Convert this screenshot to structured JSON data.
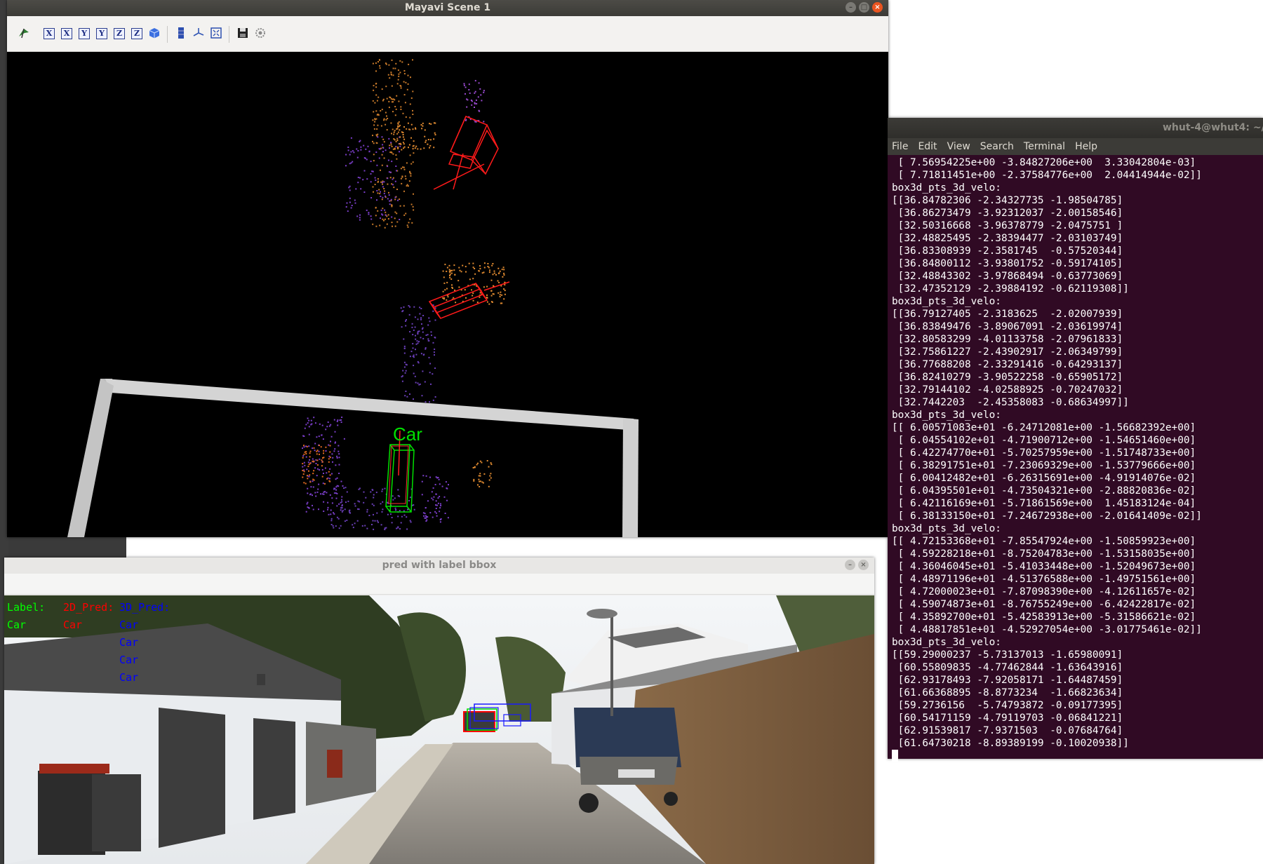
{
  "mayavi": {
    "title": "Mayavi Scene 1",
    "toolbar_icons": [
      "mayavi-logo-icon",
      "view-x-plus-icon",
      "view-x-minus-icon",
      "view-y-plus-icon",
      "view-y-minus-icon",
      "view-z-plus-icon",
      "view-z-minus-icon",
      "isometric-view-icon",
      "parallel-projection-icon",
      "axes-indicator-icon",
      "full-screen-icon",
      "save-icon",
      "configure-icon"
    ],
    "toolbar_letters": {
      "x1": "X",
      "x2": "X",
      "y1": "Y",
      "y2": "Y",
      "z1": "Z",
      "z2": "Z"
    },
    "scene_label": "Car"
  },
  "pred_window": {
    "title": "pred with label bbox",
    "legend": {
      "label_header": "Label:",
      "pred2d_header": "2D_Pred:",
      "pred3d_header": "3D_Pred:",
      "label_items": [
        "Car"
      ],
      "pred2d_items": [
        "Car"
      ],
      "pred3d_items": [
        "Car",
        "Car",
        "Car",
        "Car"
      ]
    },
    "colors": {
      "label": "#00ff00",
      "pred2d": "#ff0000",
      "pred3d": "#0000ff"
    }
  },
  "terminal": {
    "title": "whut-4@whut4: ~/",
    "menu": [
      "File",
      "Edit",
      "View",
      "Search",
      "Terminal",
      "Help"
    ],
    "lines": [
      " [ 7.56954225e+00 -3.84827206e+00  3.33042804e-03]",
      " [ 7.71811451e+00 -2.37584776e+00  2.04414944e-02]]",
      "box3d_pts_3d_velo:",
      "[[36.84782306 -2.34327735 -1.98504785]",
      " [36.86273479 -3.92312037 -2.00158546]",
      " [32.50316668 -3.96378779 -2.0475751 ]",
      " [32.48825495 -2.38394477 -2.03103749]",
      " [36.83308939 -2.3581745  -0.57520344]",
      " [36.84800112 -3.93801752 -0.59174105]",
      " [32.48843302 -3.97868494 -0.63773069]",
      " [32.47352129 -2.39884192 -0.62119308]]",
      "box3d_pts_3d_velo:",
      "[[36.79127405 -2.3183625  -2.02007939]",
      " [36.83849476 -3.89067091 -2.03619974]",
      " [32.80583299 -4.01133758 -2.07961833]",
      " [32.75861227 -2.43902917 -2.06349799]",
      " [36.77688208 -2.33291416 -0.64293137]",
      " [36.82410279 -3.90522258 -0.65905172]",
      " [32.79144102 -4.02588925 -0.70247032]",
      " [32.7442203  -2.45358083 -0.68634997]]",
      "box3d_pts_3d_velo:",
      "[[ 6.00571083e+01 -6.24712081e+00 -1.56682392e+00]",
      " [ 6.04554102e+01 -4.71900712e+00 -1.54651460e+00]",
      " [ 6.42274770e+01 -5.70257959e+00 -1.51748733e+00]",
      " [ 6.38291751e+01 -7.23069329e+00 -1.53779666e+00]",
      " [ 6.00412482e+01 -6.26315691e+00 -4.91914076e-02]",
      " [ 6.04395501e+01 -4.73504321e+00 -2.88820836e-02]",
      " [ 6.42116169e+01 -5.71861569e+00  1.45183124e-04]",
      " [ 6.38133150e+01 -7.24672938e+00 -2.01641409e-02]]",
      "box3d_pts_3d_velo:",
      "[[ 4.72153368e+01 -7.85547924e+00 -1.50859923e+00]",
      " [ 4.59228218e+01 -8.75204783e+00 -1.53158035e+00]",
      " [ 4.36046045e+01 -5.41033448e+00 -1.52049673e+00]",
      " [ 4.48971196e+01 -4.51376588e+00 -1.49751561e+00]",
      " [ 4.72000023e+01 -7.87098390e+00 -4.12611657e-02]",
      " [ 4.59074873e+01 -8.76755249e+00 -6.42422817e-02]",
      " [ 4.35892700e+01 -5.42583913e+00 -5.31586621e-02]",
      " [ 4.48817851e+01 -4.52927054e+00 -3.01775461e-02]]",
      "box3d_pts_3d_velo:",
      "[[59.29000237 -5.73137013 -1.65980091]",
      " [60.55809835 -4.77462844 -1.63643916]",
      " [62.93178493 -7.92058171 -1.64487459]",
      " [61.66368895 -8.8773234  -1.66823634]",
      " [59.2736156  -5.74793872 -0.09177395]",
      " [60.54171159 -4.79119703 -0.06841221]",
      " [62.91539817 -7.9371503  -0.07684764]",
      " [61.64730218 -8.89389199 -0.10020938]]"
    ]
  }
}
